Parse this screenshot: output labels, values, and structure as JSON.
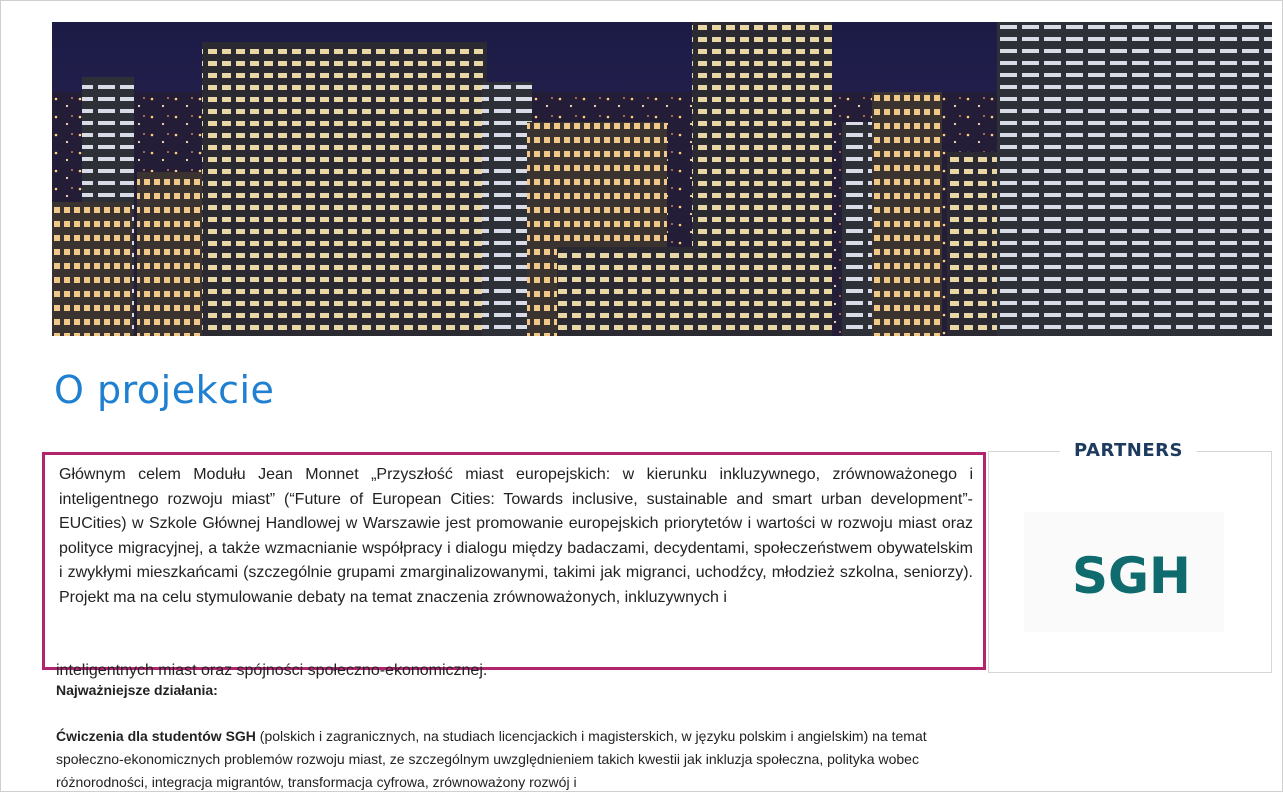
{
  "hero": {
    "image": "night-city-skyline"
  },
  "page": {
    "title": "O projekcie"
  },
  "intro": {
    "text": "Głównym celem Modułu Jean Monnet „Przyszłość miast europejskich: w kierunku inkluzywnego, zrównoważonego i inteligentnego rozwoju miast” (“Future of European Cities: Towards inclusive, sustainable and smart urban development”- EUCities) w Szkole Głównej Handlowej w Warszawie jest promowanie europejskich priorytetów i wartości w rozwoju miast oraz polityce migracyjnej, a także wzmacnianie współpracy i dialogu między badaczami, decydentami, społeczeństwem obywatelskim i zwykłymi mieszkańcami (szczególnie grupami zmarginalizowanymi, takimi jak migranci, uchodźcy, młodzież szkolna, seniorzy). Projekt ma na celu stymulowanie debaty na temat znaczenia zrównoważonych, inkluzywnych i",
    "tail": "inteligentnych miast oraz spójności społeczno-ekonomicznej.",
    "highlight_color": "#b0256d"
  },
  "activities": {
    "heading": "Najważniejsze działania:",
    "exercise_bold": "Ćwiczenia dla studentów SGH",
    "exercise_text": " (polskich i zagranicznych, na studiach licencjackich i magisterskich, w języku polskim i angielskim) na temat społeczno-ekonomicznych problemów rozwoju miast, ze szczególnym uwzględnieniem takich kwestii jak inkluzja społeczna, polityka wobec różnorodności, integracja migrantów, transformacja cyfrowa, zrównoważony rozwój i"
  },
  "partners": {
    "title": "PARTNERS",
    "logo_text": "SGH",
    "logo_color": "#0f6b6e"
  }
}
